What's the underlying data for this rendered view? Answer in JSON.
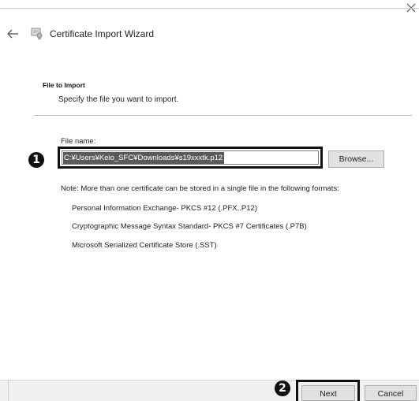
{
  "wizard": {
    "title": "Certificate Import Wizard"
  },
  "section": {
    "heading": "File to Import",
    "subtitle": "Specify the file you want to import."
  },
  "file": {
    "label": "File name:",
    "value": "C:¥Users¥Keio_SFC¥Downloads¥s19xxxtk.p12",
    "browse_label": "Browse..."
  },
  "note": "Note:  More than one certificate can be stored in a single file in the following formats:",
  "formats": [
    "Personal Information Exchange- PKCS #12 (.PFX,.P12)",
    "Cryptographic Message Syntax Standard- PKCS #7 Certificates (.P7B)",
    "Microsoft Serialized Certificate Store (.SST)"
  ],
  "markers": {
    "first": "1",
    "second": "2"
  },
  "footer": {
    "next_label": "Next",
    "cancel_label": "Cancel"
  },
  "icons": {
    "close": "close-icon",
    "back": "back-arrow-icon",
    "wizard": "certificate-icon"
  }
}
